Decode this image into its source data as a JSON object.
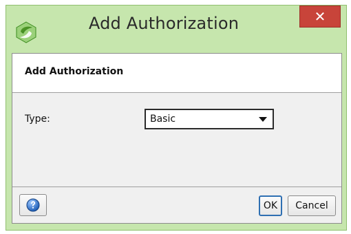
{
  "window": {
    "title": "Add Authorization",
    "close_glyph": "✕",
    "colors": {
      "titlebar_bg": "#c6e6ad",
      "close_bg": "#c8443a",
      "client_bg": "#f0f0f0",
      "accent_ok": "#2e6fb2"
    }
  },
  "dialog": {
    "header_title": "Add Authorization",
    "type_label": "Type:",
    "type_select_value": "Basic"
  },
  "footer": {
    "help_icon": "help-icon",
    "ok_label": "OK",
    "cancel_label": "Cancel"
  }
}
